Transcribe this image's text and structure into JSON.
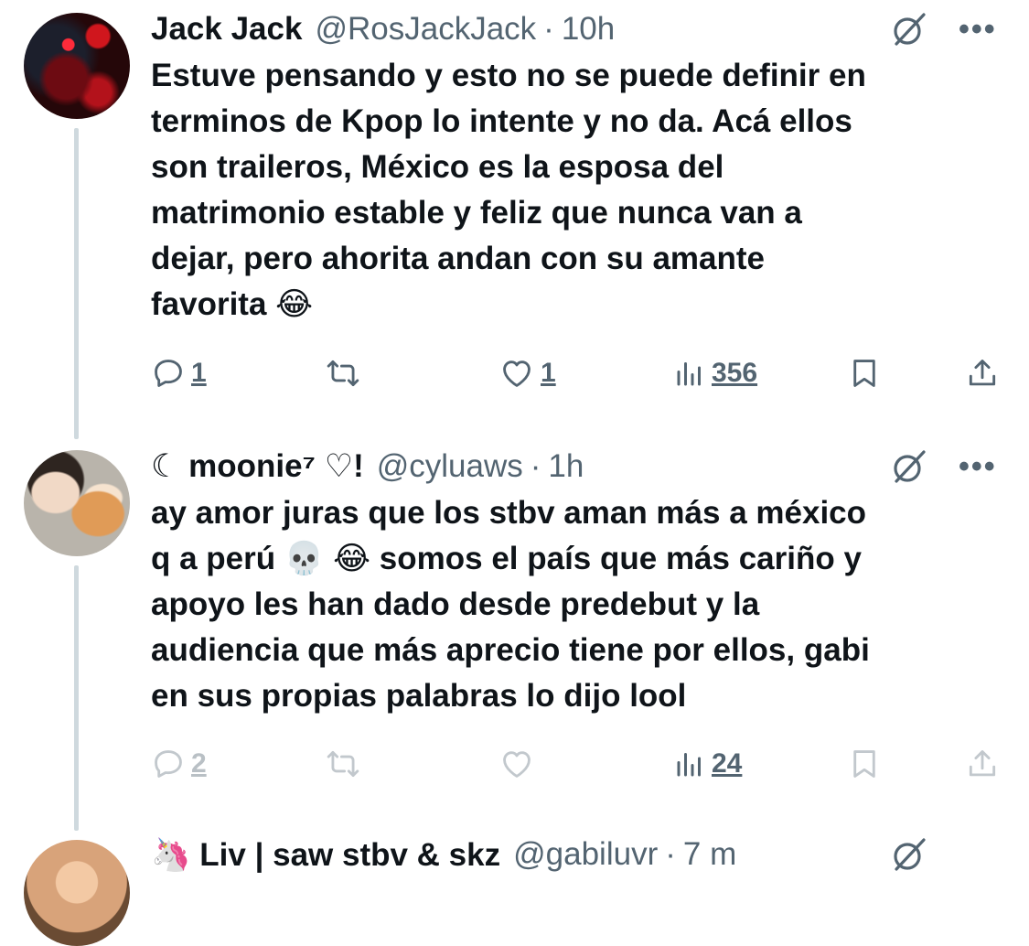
{
  "tweets": [
    {
      "name": "Jack Jack",
      "handle": "@RosJackJack",
      "separator": "·",
      "time": "10h",
      "text": "Estuve pensando y esto no se puede definir en\nterminos de Kpop lo intente y no da. Acá ellos\nson traileros, México es la esposa del\nmatrimonio estable y feliz que nunca van a\ndejar, pero ahorita andan con su amante\nfavorita 😂",
      "replies": "1",
      "retweets": "",
      "likes": "1",
      "views": "356"
    },
    {
      "name": "☾ moonie⁷ ♡!",
      "handle": "@cyluaws",
      "separator": "·",
      "time": "1h",
      "text": "ay amor juras que los stbv aman más a méxico\nq a perú 💀 😂 somos el país que más cariño y\napoyo les han dado desde predebut y la\naudiencia que más aprecio tiene por ellos, gabi\nen sus propias palabras lo dijo lool",
      "replies": "2",
      "retweets": "",
      "likes": "",
      "views": "24"
    },
    {
      "name": "🦄 Liv | saw stbv & skz",
      "handle": "@gabiluvr",
      "separator": "·",
      "time": "7 m"
    }
  ],
  "icons": {
    "more": "more-icon",
    "grok": "grok-icon",
    "reply": "reply-icon",
    "retweet": "retweet-icon",
    "like": "like-icon",
    "views": "views-icon",
    "bookmark": "bookmark-icon",
    "share": "share-icon"
  },
  "colors": {
    "text": "#0f1419",
    "secondary": "#536471",
    "thread_line": "#cfd9de",
    "background": "#ffffff"
  }
}
